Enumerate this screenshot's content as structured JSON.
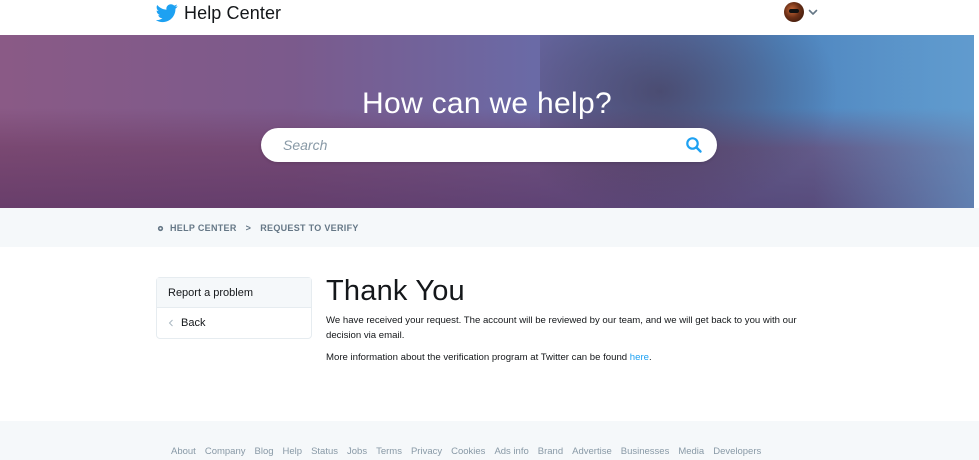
{
  "header": {
    "title": "Help Center",
    "logo_icon": "twitter-bird-icon",
    "account_menu_icon": "chevron-down-icon"
  },
  "hero": {
    "headline": "How can we help?",
    "search_placeholder": "Search",
    "search_icon": "search-icon"
  },
  "breadcrumb": {
    "items": [
      "HELP CENTER",
      "REQUEST TO VERIFY"
    ],
    "separator": ">"
  },
  "sidebar": {
    "items": [
      {
        "label": "Report a problem"
      },
      {
        "label": "Back"
      }
    ]
  },
  "main": {
    "title": "Thank You",
    "paragraph1": "We have received your request. The account will be reviewed by our team, and we will get back to you with our decision via email.",
    "paragraph2_prefix": "More information about the verification program at Twitter can be found ",
    "paragraph2_link": "here",
    "paragraph2_suffix": "."
  },
  "footer": {
    "links": [
      "About",
      "Company",
      "Blog",
      "Help",
      "Status",
      "Jobs",
      "Terms",
      "Privacy",
      "Cookies",
      "Ads info",
      "Brand",
      "Advertise",
      "Businesses",
      "Media",
      "Developers"
    ]
  },
  "colors": {
    "accent": "#1da1f2",
    "muted": "#657786",
    "background_alt": "#f5f8fa"
  }
}
